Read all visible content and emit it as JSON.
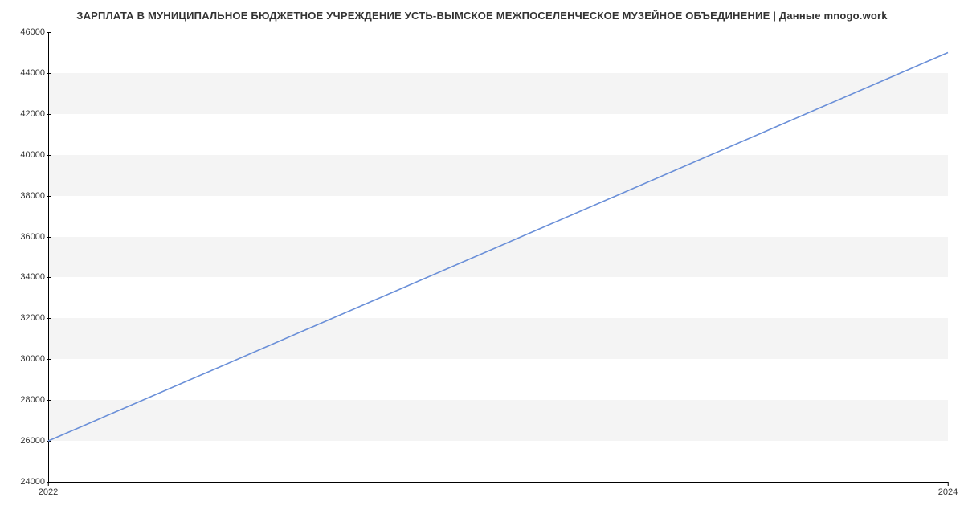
{
  "chart_data": {
    "type": "line",
    "title": "ЗАРПЛАТА В МУНИЦИПАЛЬНОЕ БЮДЖЕТНОЕ УЧРЕЖДЕНИЕ УСТЬ-ВЫМСКОЕ МЕЖПОСЕЛЕНЧЕСКОЕ МУЗЕЙНОЕ ОБЪЕДИНЕНИЕ | Данные mnogo.work",
    "xlabel": "",
    "ylabel": "",
    "x": [
      2022,
      2024
    ],
    "values": [
      26000,
      45000
    ],
    "xlim": [
      2022,
      2024
    ],
    "ylim": [
      24000,
      46000
    ],
    "y_ticks": [
      24000,
      26000,
      28000,
      30000,
      32000,
      34000,
      36000,
      38000,
      40000,
      42000,
      44000,
      46000
    ],
    "x_ticks": [
      2022,
      2024
    ],
    "line_color": "#6a8fd8",
    "grid_stripe_light": "#ffffff",
    "grid_stripe_dark": "#f4f4f4"
  }
}
